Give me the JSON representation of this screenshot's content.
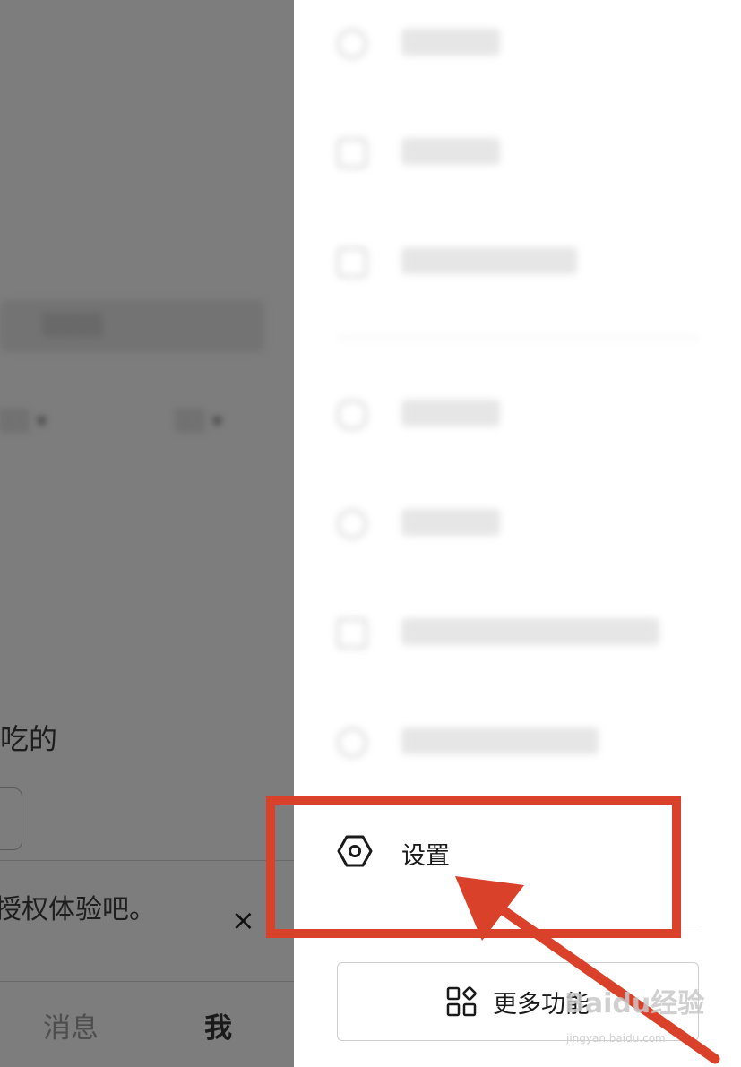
{
  "background_app": {
    "partial_title_text": "吃的",
    "notice_text": "授权体验吧。",
    "close_symbol": "×",
    "tabs": [
      {
        "label": "消息"
      },
      {
        "label": "我"
      }
    ]
  },
  "drawer": {
    "settings_label": "设置",
    "more_features_label": "更多功能"
  },
  "annotation": {
    "highlight_color": "#d9412a"
  },
  "watermark": {
    "brand": "Baidu经验",
    "url": "jingyan.baidu.com"
  }
}
